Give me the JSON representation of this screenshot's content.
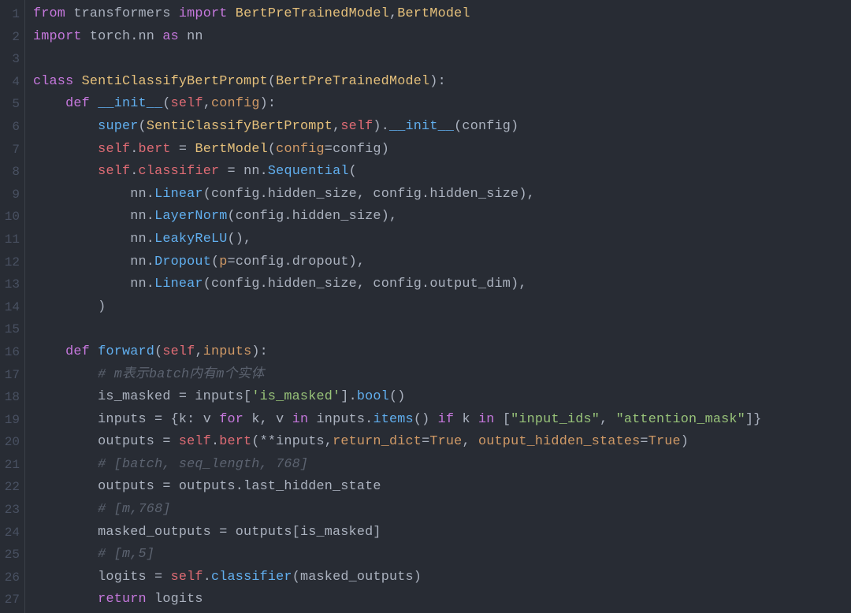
{
  "editor": {
    "language": "python",
    "theme": "one-dark",
    "line_count": 27,
    "lines": [
      {
        "n": 1,
        "tokens": [
          [
            "kw",
            "from"
          ],
          [
            "op",
            " transformers "
          ],
          [
            "kw",
            "import"
          ],
          [
            "op",
            " "
          ],
          [
            "cls",
            "BertPreTrainedModel"
          ],
          [
            "punc",
            ","
          ],
          [
            "cls",
            "BertModel"
          ]
        ]
      },
      {
        "n": 2,
        "tokens": [
          [
            "kw",
            "import"
          ],
          [
            "op",
            " torch"
          ],
          [
            "punc",
            "."
          ],
          [
            "op",
            "nn "
          ],
          [
            "kw",
            "as"
          ],
          [
            "op",
            " nn"
          ]
        ]
      },
      {
        "n": 3,
        "tokens": []
      },
      {
        "n": 4,
        "tokens": [
          [
            "kw",
            "class"
          ],
          [
            "op",
            " "
          ],
          [
            "cls",
            "SentiClassifyBertPrompt"
          ],
          [
            "punc",
            "("
          ],
          [
            "cls",
            "BertPreTrainedModel"
          ],
          [
            "punc",
            "):"
          ]
        ]
      },
      {
        "n": 5,
        "tokens": [
          [
            "op",
            "    "
          ],
          [
            "kw",
            "def"
          ],
          [
            "op",
            " "
          ],
          [
            "fn",
            "__init__"
          ],
          [
            "punc",
            "("
          ],
          [
            "self",
            "self"
          ],
          [
            "punc",
            ","
          ],
          [
            "param",
            "config"
          ],
          [
            "punc",
            "):"
          ]
        ]
      },
      {
        "n": 6,
        "tokens": [
          [
            "op",
            "        "
          ],
          [
            "fn",
            "super"
          ],
          [
            "punc",
            "("
          ],
          [
            "cls",
            "SentiClassifyBertPrompt"
          ],
          [
            "punc",
            ","
          ],
          [
            "self",
            "self"
          ],
          [
            "punc",
            ")."
          ],
          [
            "fn",
            "__init__"
          ],
          [
            "punc",
            "("
          ],
          [
            "op",
            "config"
          ],
          [
            "punc",
            ")"
          ]
        ]
      },
      {
        "n": 7,
        "tokens": [
          [
            "op",
            "        "
          ],
          [
            "self",
            "self"
          ],
          [
            "punc",
            "."
          ],
          [
            "attr",
            "bert"
          ],
          [
            "op",
            " = "
          ],
          [
            "cls",
            "BertModel"
          ],
          [
            "punc",
            "("
          ],
          [
            "param",
            "config"
          ],
          [
            "op",
            "="
          ],
          [
            "op",
            "config"
          ],
          [
            "punc",
            ")"
          ]
        ]
      },
      {
        "n": 8,
        "tokens": [
          [
            "op",
            "        "
          ],
          [
            "self",
            "self"
          ],
          [
            "punc",
            "."
          ],
          [
            "attr",
            "classifier"
          ],
          [
            "op",
            " = nn"
          ],
          [
            "punc",
            "."
          ],
          [
            "fn",
            "Sequential"
          ],
          [
            "punc",
            "("
          ]
        ]
      },
      {
        "n": 9,
        "tokens": [
          [
            "op",
            "            nn"
          ],
          [
            "punc",
            "."
          ],
          [
            "fn",
            "Linear"
          ],
          [
            "punc",
            "("
          ],
          [
            "op",
            "config"
          ],
          [
            "punc",
            "."
          ],
          [
            "op",
            "hidden_size"
          ],
          [
            "punc",
            ", "
          ],
          [
            "op",
            "config"
          ],
          [
            "punc",
            "."
          ],
          [
            "op",
            "hidden_size"
          ],
          [
            "punc",
            "),"
          ]
        ]
      },
      {
        "n": 10,
        "tokens": [
          [
            "op",
            "            nn"
          ],
          [
            "punc",
            "."
          ],
          [
            "fn",
            "LayerNorm"
          ],
          [
            "punc",
            "("
          ],
          [
            "op",
            "config"
          ],
          [
            "punc",
            "."
          ],
          [
            "op",
            "hidden_size"
          ],
          [
            "punc",
            "),"
          ]
        ]
      },
      {
        "n": 11,
        "tokens": [
          [
            "op",
            "            nn"
          ],
          [
            "punc",
            "."
          ],
          [
            "fn",
            "LeakyReLU"
          ],
          [
            "punc",
            "(),"
          ]
        ]
      },
      {
        "n": 12,
        "tokens": [
          [
            "op",
            "            nn"
          ],
          [
            "punc",
            "."
          ],
          [
            "fn",
            "Dropout"
          ],
          [
            "punc",
            "("
          ],
          [
            "param",
            "p"
          ],
          [
            "op",
            "="
          ],
          [
            "op",
            "config"
          ],
          [
            "punc",
            "."
          ],
          [
            "op",
            "dropout"
          ],
          [
            "punc",
            "),"
          ]
        ]
      },
      {
        "n": 13,
        "tokens": [
          [
            "op",
            "            nn"
          ],
          [
            "punc",
            "."
          ],
          [
            "fn",
            "Linear"
          ],
          [
            "punc",
            "("
          ],
          [
            "op",
            "config"
          ],
          [
            "punc",
            "."
          ],
          [
            "op",
            "hidden_size"
          ],
          [
            "punc",
            ", "
          ],
          [
            "op",
            "config"
          ],
          [
            "punc",
            "."
          ],
          [
            "op",
            "output_dim"
          ],
          [
            "punc",
            "),"
          ]
        ]
      },
      {
        "n": 14,
        "tokens": [
          [
            "op",
            "        "
          ],
          [
            "punc",
            ")"
          ]
        ]
      },
      {
        "n": 15,
        "tokens": []
      },
      {
        "n": 16,
        "tokens": [
          [
            "op",
            "    "
          ],
          [
            "kw",
            "def"
          ],
          [
            "op",
            " "
          ],
          [
            "fn",
            "forward"
          ],
          [
            "punc",
            "("
          ],
          [
            "self",
            "self"
          ],
          [
            "punc",
            ","
          ],
          [
            "param",
            "inputs"
          ],
          [
            "punc",
            "):"
          ]
        ]
      },
      {
        "n": 17,
        "tokens": [
          [
            "op",
            "        "
          ],
          [
            "cmt",
            "# m表示batch内有m个实体"
          ]
        ]
      },
      {
        "n": 18,
        "tokens": [
          [
            "op",
            "        is_masked = inputs"
          ],
          [
            "punc",
            "["
          ],
          [
            "str",
            "'is_masked'"
          ],
          [
            "punc",
            "]."
          ],
          [
            "fn",
            "bool"
          ],
          [
            "punc",
            "()"
          ]
        ]
      },
      {
        "n": 19,
        "tokens": [
          [
            "op",
            "        inputs = "
          ],
          [
            "punc",
            "{"
          ],
          [
            "op",
            "k"
          ],
          [
            "punc",
            ": "
          ],
          [
            "op",
            "v "
          ],
          [
            "kw",
            "for"
          ],
          [
            "op",
            " k"
          ],
          [
            "punc",
            ", "
          ],
          [
            "op",
            "v "
          ],
          [
            "kw",
            "in"
          ],
          [
            "op",
            " inputs"
          ],
          [
            "punc",
            "."
          ],
          [
            "fn",
            "items"
          ],
          [
            "punc",
            "() "
          ],
          [
            "kw",
            "if"
          ],
          [
            "op",
            " k "
          ],
          [
            "kw",
            "in"
          ],
          [
            "op",
            " "
          ],
          [
            "punc",
            "["
          ],
          [
            "str",
            "\"input_ids\""
          ],
          [
            "punc",
            ", "
          ],
          [
            "str",
            "\"attention_mask\""
          ],
          [
            "punc",
            "]}"
          ]
        ]
      },
      {
        "n": 20,
        "tokens": [
          [
            "op",
            "        outputs = "
          ],
          [
            "self",
            "self"
          ],
          [
            "punc",
            "."
          ],
          [
            "attr",
            "bert"
          ],
          [
            "punc",
            "("
          ],
          [
            "op",
            "**inputs"
          ],
          [
            "punc",
            ","
          ],
          [
            "param",
            "return_dict"
          ],
          [
            "op",
            "="
          ],
          [
            "bool",
            "True"
          ],
          [
            "punc",
            ", "
          ],
          [
            "param",
            "output_hidden_states"
          ],
          [
            "op",
            "="
          ],
          [
            "bool",
            "True"
          ],
          [
            "punc",
            ")"
          ]
        ]
      },
      {
        "n": 21,
        "tokens": [
          [
            "op",
            "        "
          ],
          [
            "cmt",
            "# [batch, seq_length, 768]"
          ]
        ]
      },
      {
        "n": 22,
        "tokens": [
          [
            "op",
            "        outputs = outputs"
          ],
          [
            "punc",
            "."
          ],
          [
            "op",
            "last_hidden_state"
          ]
        ]
      },
      {
        "n": 23,
        "tokens": [
          [
            "op",
            "        "
          ],
          [
            "cmt",
            "# [m,768]"
          ]
        ]
      },
      {
        "n": 24,
        "tokens": [
          [
            "op",
            "        masked_outputs = outputs"
          ],
          [
            "punc",
            "["
          ],
          [
            "op",
            "is_masked"
          ],
          [
            "punc",
            "]"
          ]
        ]
      },
      {
        "n": 25,
        "tokens": [
          [
            "op",
            "        "
          ],
          [
            "cmt",
            "# [m,5]"
          ]
        ]
      },
      {
        "n": 26,
        "tokens": [
          [
            "op",
            "        logits = "
          ],
          [
            "self",
            "self"
          ],
          [
            "punc",
            "."
          ],
          [
            "fn",
            "classifier"
          ],
          [
            "punc",
            "("
          ],
          [
            "op",
            "masked_outputs"
          ],
          [
            "punc",
            ")"
          ]
        ]
      },
      {
        "n": 27,
        "tokens": [
          [
            "op",
            "        "
          ],
          [
            "kw",
            "return"
          ],
          [
            "op",
            " logits"
          ]
        ]
      }
    ]
  }
}
